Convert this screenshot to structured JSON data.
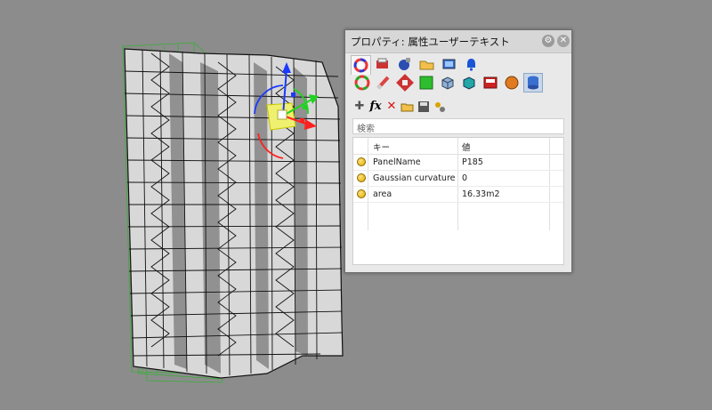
{
  "panel": {
    "title": "プロパティ: 属性ユーザーテキスト",
    "settings_icon": "gear-icon",
    "close_icon": "close-icon",
    "tabs": [
      "color-wheel-icon",
      "material-icon",
      "render-icon",
      "folder-icon",
      "display-icon",
      "notification-icon"
    ],
    "section_icons": [
      "color-wheel-icon",
      "pencil-icon",
      "link-icon",
      "green-square-icon",
      "cube-icon",
      "teal-box-icon",
      "red-box-icon",
      "sphere-icon",
      "database-icon"
    ],
    "toolbar": [
      "add-icon",
      "function-icon",
      "delete-icon",
      "open-folder-icon",
      "save-icon",
      "settings-icon"
    ],
    "search_placeholder": "検索",
    "columns": {
      "key": "キー",
      "value": "値"
    },
    "rows": [
      {
        "key": "PanelName",
        "value": "P185"
      },
      {
        "key": "Gaussian curvature",
        "value": "0"
      },
      {
        "key": "area",
        "value": "16.33m2"
      }
    ]
  },
  "colors": {
    "background": "#8c8c8c",
    "panel_bg": "#e9e9e9",
    "wireframe": "#2aa02a",
    "active_icon": "#c8d7ea"
  }
}
